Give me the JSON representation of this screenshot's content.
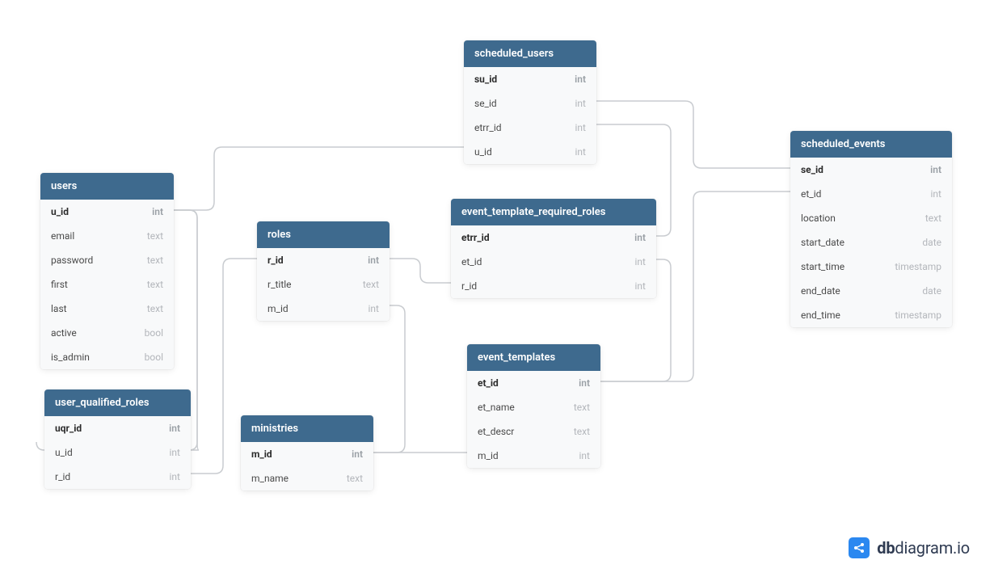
{
  "watermark": {
    "bold": "db",
    "rest": "diagram.io"
  },
  "tables": {
    "users": {
      "title": "users",
      "cols": [
        {
          "name": "u_id",
          "type": "int",
          "pk": true
        },
        {
          "name": "email",
          "type": "text"
        },
        {
          "name": "password",
          "type": "text"
        },
        {
          "name": "first",
          "type": "text"
        },
        {
          "name": "last",
          "type": "text"
        },
        {
          "name": "active",
          "type": "bool"
        },
        {
          "name": "is_admin",
          "type": "bool"
        }
      ]
    },
    "user_qualified_roles": {
      "title": "user_qualified_roles",
      "cols": [
        {
          "name": "uqr_id",
          "type": "int",
          "pk": true
        },
        {
          "name": "u_id",
          "type": "int"
        },
        {
          "name": "r_id",
          "type": "int"
        }
      ]
    },
    "roles": {
      "title": "roles",
      "cols": [
        {
          "name": "r_id",
          "type": "int",
          "pk": true
        },
        {
          "name": "r_title",
          "type": "text"
        },
        {
          "name": "m_id",
          "type": "int"
        }
      ]
    },
    "ministries": {
      "title": "ministries",
      "cols": [
        {
          "name": "m_id",
          "type": "int",
          "pk": true
        },
        {
          "name": "m_name",
          "type": "text"
        }
      ]
    },
    "scheduled_users": {
      "title": "scheduled_users",
      "cols": [
        {
          "name": "su_id",
          "type": "int",
          "pk": true
        },
        {
          "name": "se_id",
          "type": "int"
        },
        {
          "name": "etrr_id",
          "type": "int"
        },
        {
          "name": "u_id",
          "type": "int"
        }
      ]
    },
    "event_template_required_roles": {
      "title": "event_template_required_roles",
      "cols": [
        {
          "name": "etrr_id",
          "type": "int",
          "pk": true
        },
        {
          "name": "et_id",
          "type": "int"
        },
        {
          "name": "r_id",
          "type": "int"
        }
      ]
    },
    "event_templates": {
      "title": "event_templates",
      "cols": [
        {
          "name": "et_id",
          "type": "int",
          "pk": true
        },
        {
          "name": "et_name",
          "type": "text"
        },
        {
          "name": "et_descr",
          "type": "text"
        },
        {
          "name": "m_id",
          "type": "int"
        }
      ]
    },
    "scheduled_events": {
      "title": "scheduled_events",
      "cols": [
        {
          "name": "se_id",
          "type": "int",
          "pk": true
        },
        {
          "name": "et_id",
          "type": "int"
        },
        {
          "name": "location",
          "type": "text"
        },
        {
          "name": "start_date",
          "type": "date"
        },
        {
          "name": "start_time",
          "type": "timestamp"
        },
        {
          "name": "end_date",
          "type": "date"
        },
        {
          "name": "end_time",
          "type": "timestamp"
        }
      ]
    }
  }
}
